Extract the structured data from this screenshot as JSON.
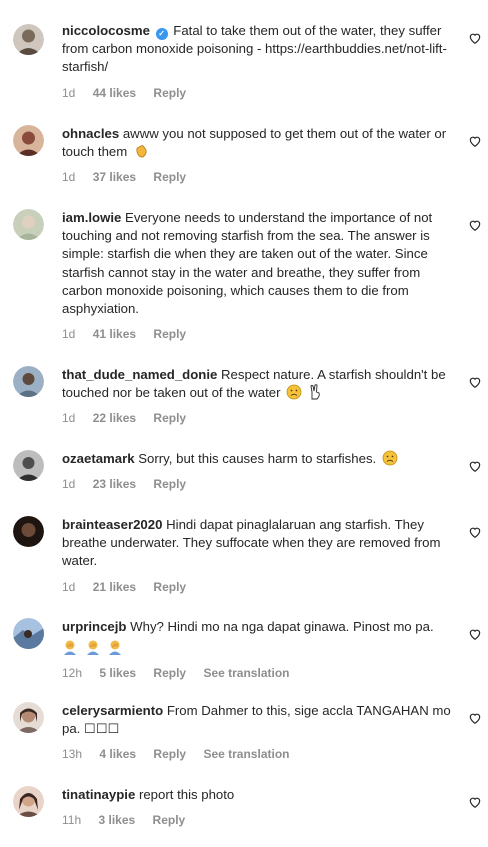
{
  "comments": [
    {
      "user": "niccolocosme",
      "verified": true,
      "text": "Fatal to take them out of the water, they suffer from carbon monoxide poisoning - https://earthbuddies.net/not-lift-starfish/",
      "time": "1d",
      "likes": "44 likes",
      "reply": "Reply",
      "avatar_color": "#7a6a5c"
    },
    {
      "user": "ohnacles",
      "text": "awww you not supposed to get them out of the water or touch them",
      "emoji": "waving-hand-emoji",
      "time": "1d",
      "likes": "37 likes",
      "reply": "Reply",
      "avatar_color": "#8a4b3c"
    },
    {
      "user": "iam.lowie",
      "text": "Everyone needs to understand the importance of not touching and not removing starfish from the sea. The answer is simple: starfish die when they are taken out of the water. Since starfish cannot stay in the water and breathe, they suffer from carbon monoxide poisoning, which causes them to die from asphyxiation.",
      "time": "1d",
      "likes": "41 likes",
      "reply": "Reply",
      "avatar_color": "#a9b59a"
    },
    {
      "user": "that_dude_named_donie",
      "text": "Respect nature. A starfish shouldn't be touched nor be taken out of the water",
      "emoji": "sad-face-and-hand-emoji",
      "time": "1d",
      "likes": "22 likes",
      "reply": "Reply",
      "avatar_color": "#5d7184"
    },
    {
      "user": "ozaetamark",
      "text": "Sorry, but this causes harm to starfishes.",
      "emoji": "sad-face-emoji",
      "time": "1d",
      "likes": "23 likes",
      "reply": "Reply",
      "avatar_color": "#4e4e4e"
    },
    {
      "user": "brainteaser2020",
      "text": "Hindi dapat pinaglalaruan ang starfish. They breathe underwater. They suffocate when they are removed from water.",
      "time": "1d",
      "likes": "21 likes",
      "reply": "Reply",
      "avatar_color": "#3a2a22"
    },
    {
      "user": "urprincejb",
      "text": "Why? Hindi mo na nga dapat ginawa. Pinost mo pa.",
      "emoji": "facepalm-emojis",
      "time": "12h",
      "likes": "5 likes",
      "reply": "Reply",
      "translate": "See translation",
      "avatar_color": "#5a7aa0"
    },
    {
      "user": "celerysarmiento",
      "text": "From Dahmer to this, sige accla TANGAHAN mo pa. ☐☐☐",
      "time": "13h",
      "likes": "4 likes",
      "reply": "Reply",
      "translate": "See translation",
      "avatar_color": "#7d6a62"
    },
    {
      "user": "tinatinaypie",
      "text": "report this photo",
      "time": "11h",
      "likes": "3 likes",
      "reply": "Reply",
      "avatar_color": "#6a4e44"
    }
  ]
}
